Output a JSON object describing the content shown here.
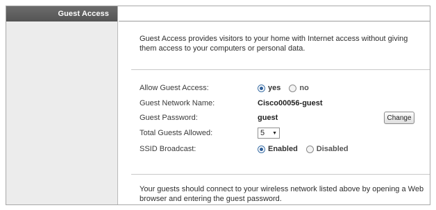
{
  "sidebar": {
    "title": "Guest Access"
  },
  "intro": "Guest Access provides visitors to your home with Internet access without giving them access to your computers or personal data.",
  "fields": {
    "allow": {
      "label": "Allow Guest Access:",
      "yes": "yes",
      "no": "no",
      "selected": "yes"
    },
    "network_name": {
      "label": "Guest Network Name:",
      "value": "Cisco00056-guest"
    },
    "password": {
      "label": "Guest Password:",
      "value": "guest",
      "button": "Change"
    },
    "total": {
      "label": "Total Guests Allowed:",
      "value": "5"
    },
    "ssid": {
      "label": "SSID Broadcast:",
      "enabled": "Enabled",
      "disabled": "Disabled",
      "selected": "Enabled"
    }
  },
  "footer": "Your guests should connect to your wireless network listed above by opening a Web browser and entering the guest password.",
  "colors": {
    "header_bg": "#5f5f5f",
    "sidebar_bg": "#ececec",
    "radio_accent": "#2f5f99"
  }
}
